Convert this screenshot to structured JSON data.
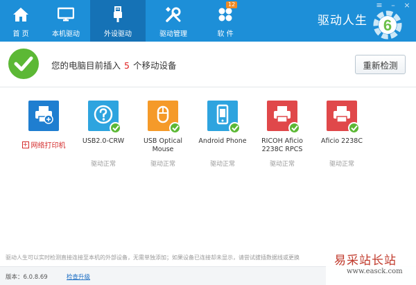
{
  "nav": {
    "items": [
      {
        "label": "首 页",
        "icon": "home-icon"
      },
      {
        "label": "本机驱动",
        "icon": "monitor-icon"
      },
      {
        "label": "外设驱动",
        "icon": "usb-icon"
      },
      {
        "label": "驱动管理",
        "icon": "tools-icon"
      },
      {
        "label": "软 件",
        "icon": "apps-icon",
        "badge": "12"
      }
    ],
    "active": "外设驱动"
  },
  "brand": {
    "name": "驱动人生",
    "logo_digit": "6"
  },
  "status": {
    "prefix": "您的电脑目前插入",
    "count": "5",
    "suffix": "个移动设备",
    "recheck_label": "重新检测"
  },
  "devices": [
    {
      "name": "网络打印机",
      "kind": "add",
      "icon": "printer-icon"
    },
    {
      "name": "USB2.0-CRW",
      "status": "驱动正常",
      "icon": "question-icon",
      "color": "blue"
    },
    {
      "name": "USB Optical Mouse",
      "status": "驱动正常",
      "icon": "mouse-icon",
      "color": "orange"
    },
    {
      "name": "Android Phone",
      "status": "驱动正常",
      "icon": "phone-icon",
      "color": "blue"
    },
    {
      "name": "RICOH Aficio 2238C RPCS",
      "status": "驱动正常",
      "icon": "printer-icon",
      "color": "red"
    },
    {
      "name": "Aficio 2238C",
      "status": "驱动正常",
      "icon": "printer-icon",
      "color": "red"
    }
  ],
  "hint": "驱动人生可以实时检测直接连接至本机的外部设备，无需单独添加；如果设备已连接却未显示，请尝试拔插数据线或更换",
  "footer": {
    "version": "版本：6.0.8.69",
    "update_label": "检查升级"
  },
  "watermark": {
    "title": "易采站长站",
    "url": "www.easck.com"
  },
  "colors": {
    "nav_bg": "#1d8fd8",
    "nav_active": "#1572b6",
    "ok_green": "#5cb835",
    "alert_red": "#e02020"
  }
}
